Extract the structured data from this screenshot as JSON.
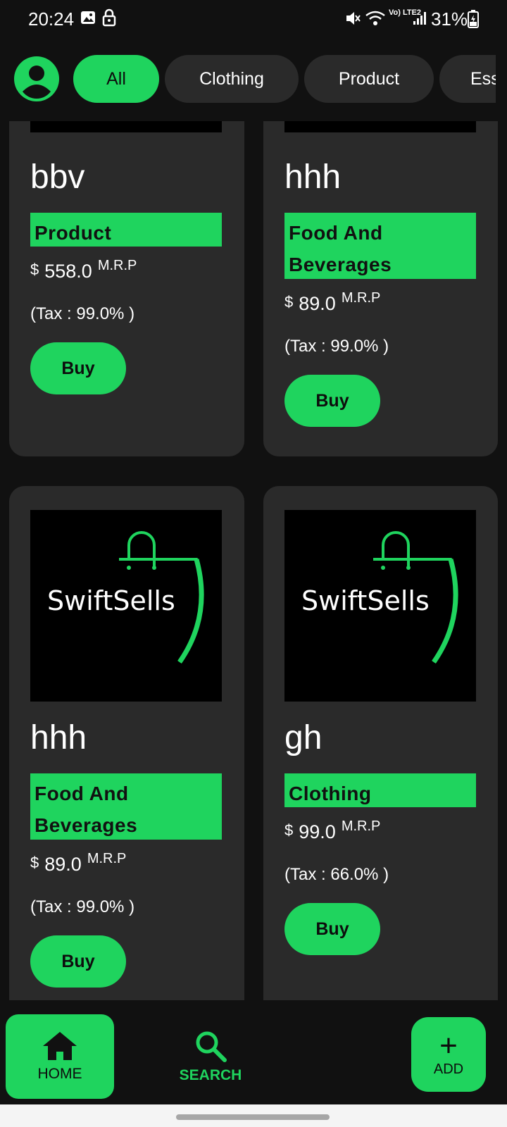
{
  "status_bar": {
    "time": "20:24",
    "network": "Vo) LTE2",
    "battery": "31%"
  },
  "categories": [
    {
      "label": "All",
      "active": true
    },
    {
      "label": "Clothing",
      "active": false
    },
    {
      "label": "Product",
      "active": false
    },
    {
      "label": "Ess",
      "active": false
    }
  ],
  "products": [
    {
      "title": "bbv",
      "category": "Product",
      "currency": "$",
      "price": "558.0",
      "mrp_label": "M.R.P",
      "tax": "(Tax : 99.0% )",
      "buy_label": "Buy",
      "has_image": true
    },
    {
      "title": "hhh",
      "category": "Food And Beverages",
      "currency": "$",
      "price": "89.0",
      "mrp_label": "M.R.P",
      "tax": "(Tax : 99.0% )",
      "buy_label": "Buy",
      "has_image": true
    },
    {
      "title": "hhh",
      "category": "Food And Beverages",
      "currency": "$",
      "price": "89.0",
      "mrp_label": "M.R.P",
      "tax": "(Tax : 99.0% )",
      "buy_label": "Buy",
      "image_logo_text": "SwiftSells"
    },
    {
      "title": "gh",
      "category": "Clothing",
      "currency": "$",
      "price": "99.0",
      "mrp_label": "M.R.P",
      "tax": "(Tax : 66.0% )",
      "buy_label": "Buy",
      "image_logo_text": "SwiftSells"
    }
  ],
  "bottom_nav": {
    "home_label": "HOME",
    "search_label": "SEARCH",
    "add_label": "ADD"
  },
  "colors": {
    "accent": "#1fd45e",
    "background": "#111111",
    "card": "#2a2a2a"
  },
  "icons": {
    "avatar": "person-icon",
    "home": "home-icon",
    "search": "search-icon",
    "add": "plus-icon"
  }
}
